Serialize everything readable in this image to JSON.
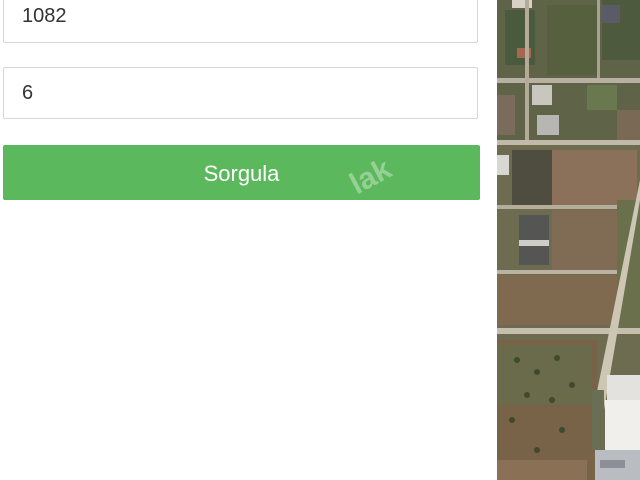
{
  "form": {
    "ada_value": "1082",
    "parsel_value": "6",
    "submit_label": "Sorgula"
  },
  "watermark": "lak",
  "map": {
    "view": "satellite"
  }
}
